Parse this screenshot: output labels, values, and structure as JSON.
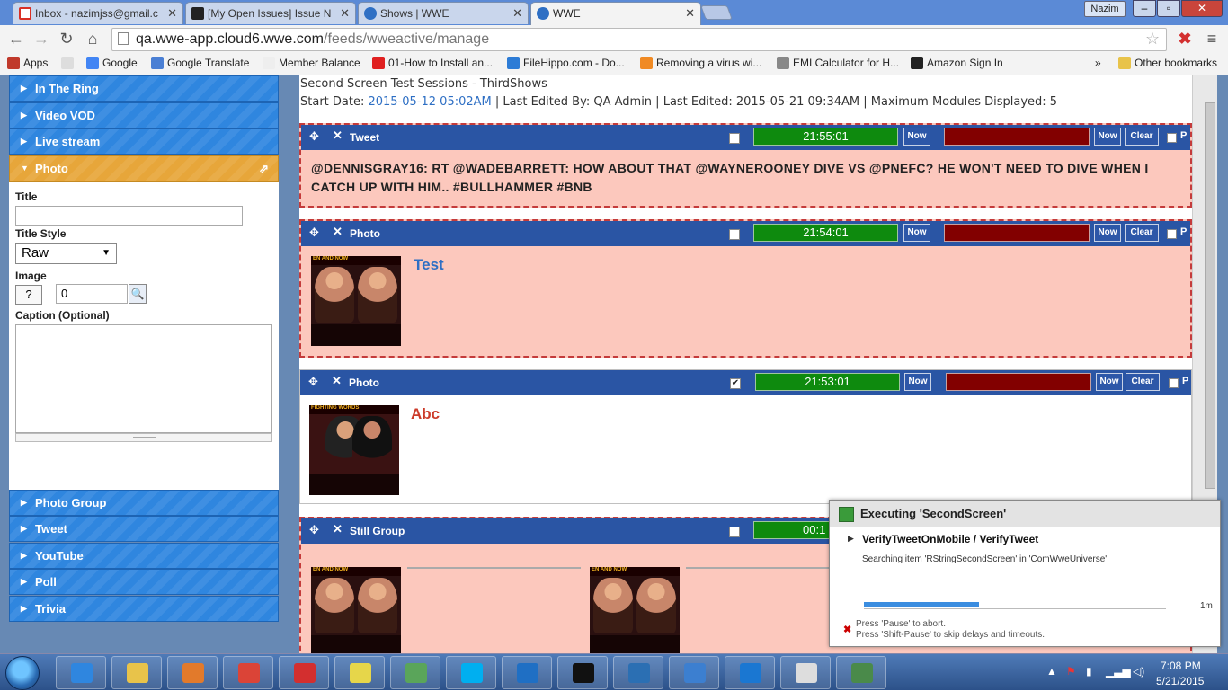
{
  "browser": {
    "tabs": [
      {
        "label": "Inbox - nazimjss@gmail.c",
        "color": "#d93025"
      },
      {
        "label": "[My Open Issues] Issue N",
        "color": "#222222"
      },
      {
        "label": "Shows | WWE",
        "color": "#2e6fc4"
      },
      {
        "label": "WWE",
        "color": "#2e6fc4"
      }
    ],
    "user": "Nazim",
    "url_host": "qa.wwe-app.cloud6.wwe.com",
    "url_path": "/feeds/wweactive/manage",
    "bookmarks": [
      {
        "label": "Apps",
        "color": "#c0392b"
      },
      {
        "label": "",
        "color": "#dddddd"
      },
      {
        "label": "Google",
        "color": "#4285f4"
      },
      {
        "label": "Google Translate",
        "color": "#4a7fd4"
      },
      {
        "label": "Member Balance",
        "color": "#eeeeee"
      },
      {
        "label": "01-How to Install an...",
        "color": "#e02020"
      },
      {
        "label": "FileHippo.com - Do...",
        "color": "#2d7cd6"
      },
      {
        "label": "Removing a virus wi...",
        "color": "#f08a24"
      },
      {
        "label": "EMI Calculator for H...",
        "color": "#888888"
      },
      {
        "label": "Amazon Sign In",
        "color": "#222222"
      }
    ],
    "other_bookmarks": "Other bookmarks"
  },
  "sidebar": {
    "items": [
      "In The Ring",
      "Video VOD",
      "Live stream",
      "Photo",
      "Photo Group",
      "Tweet",
      "YouTube",
      "Poll",
      "Trivia"
    ],
    "form": {
      "title_label": "Title",
      "title_style_label": "Title Style",
      "title_style_value": "Raw",
      "image_label": "Image",
      "help": "?",
      "image_value": "0",
      "caption_label": "Caption (Optional)"
    }
  },
  "session": {
    "title": "Second Screen Test Sessions - ThirdShows",
    "start_label": "Start Date:",
    "start_date": "2015-05-12 05:02AM",
    "edited_by": "Last Edited By: QA Admin",
    "last_edited": "Last Edited: 2015-05-21 09:34AM",
    "max_modules": "Maximum Modules Displayed: 5"
  },
  "modules": [
    {
      "type": "Tweet",
      "checked": false,
      "time": "21:55:01",
      "text": "@DENNISGRAY16: RT @WADEBARRETT: HOW ABOUT THAT @WAYNEROONEY DIVE VS @PNEFC? HE WON'T NEED TO DIVE WHEN I CATCH UP WITH HIM.. #BULLHAMMER #BNB"
    },
    {
      "type": "Photo",
      "checked": false,
      "time": "21:54:01",
      "title": "Test",
      "title_color": "#2e6fc4"
    },
    {
      "type": "Photo",
      "checked": true,
      "time": "21:53:01",
      "title": "Abc",
      "title_color": "#cc3b2a"
    },
    {
      "type": "Still Group",
      "checked": false,
      "time": "00:1"
    }
  ],
  "module_buttons": {
    "now": "Now",
    "clear": "Clear",
    "p": "P",
    "check": "✔"
  },
  "thumbs": {
    "banner1": "EN AND NOW",
    "banner2": "FIGHTING WORDS"
  },
  "exec": {
    "title": "Executing 'SecondScreen'",
    "task": "VerifyTweetOnMobile / VerifyTweet",
    "status": "Searching item 'RStringSecondScreen' in 'ComWweUniverse'",
    "progress": 0.38,
    "time": "1m",
    "hint1": "Press 'Pause' to abort.",
    "hint2": "Press 'Shift-Pause' to skip delays and timeouts."
  },
  "taskbar": {
    "apps": [
      {
        "name": "ie",
        "color": "#2f86df"
      },
      {
        "name": "explorer",
        "color": "#e8c34a"
      },
      {
        "name": "media",
        "color": "#e27a2b"
      },
      {
        "name": "chrome",
        "color": "#db4437"
      },
      {
        "name": "tool",
        "color": "#d32f2f"
      },
      {
        "name": "notes",
        "color": "#e6d64a"
      },
      {
        "name": "editor",
        "color": "#5aa55a"
      },
      {
        "name": "skype",
        "color": "#00aff0"
      },
      {
        "name": "outlook",
        "color": "#1f6fc4"
      },
      {
        "name": "cmd",
        "color": "#111111"
      },
      {
        "name": "search",
        "color": "#2b6fb3"
      },
      {
        "name": "device",
        "color": "#3c7fd0"
      },
      {
        "name": "teamviewer",
        "color": "#1a77d2"
      },
      {
        "name": "ranorex",
        "color": "#dddddd"
      },
      {
        "name": "slides",
        "color": "#4a8a4a"
      }
    ],
    "time": "7:08 PM",
    "date": "5/21/2015"
  }
}
